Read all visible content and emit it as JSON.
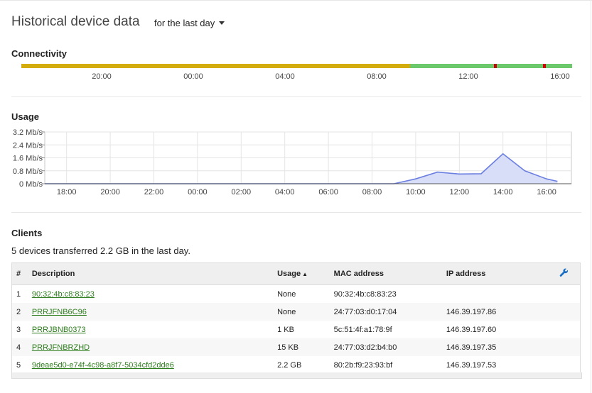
{
  "page": {
    "title": "Historical device data",
    "range_label": "for the last day"
  },
  "connectivity": {
    "title": "Connectivity",
    "colors": {
      "poor": "#d4ac0d",
      "good": "#6bc96b",
      "offline": "#cc0000"
    },
    "ticks": [
      "20:00",
      "00:00",
      "04:00",
      "08:00",
      "12:00",
      "16:00"
    ]
  },
  "usage": {
    "title": "Usage",
    "line_color": "#6b7fe0",
    "fill_color": "#d8ddf8"
  },
  "chart_data": {
    "type": "area",
    "title": "",
    "xlabel": "",
    "ylabel": "",
    "y_unit": "Mb/s",
    "y_ticks": [
      "0 Mb/s",
      "0.8 Mb/s",
      "1.6 Mb/s",
      "2.4 Mb/s",
      "3.2 Mb/s"
    ],
    "ylim": [
      0,
      3.2
    ],
    "x_ticks": [
      "18:00",
      "20:00",
      "22:00",
      "00:00",
      "02:00",
      "04:00",
      "06:00",
      "08:00",
      "10:00",
      "12:00",
      "14:00",
      "16:00"
    ],
    "grid": true,
    "series": [
      {
        "x": [
          "17:00",
          "18:00",
          "19:00",
          "20:00",
          "21:00",
          "22:00",
          "23:00",
          "00:00",
          "01:00",
          "02:00",
          "03:00",
          "04:00",
          "05:00",
          "06:00",
          "07:00",
          "08:00",
          "09:00",
          "10:00",
          "11:00",
          "12:00",
          "13:00",
          "14:00",
          "15:00",
          "16:00",
          "16:30"
        ],
        "values": [
          0,
          0,
          0,
          0,
          0,
          0,
          0,
          0,
          0,
          0,
          0,
          0,
          0,
          0,
          0,
          0,
          0,
          0.3,
          0.72,
          0.6,
          0.62,
          1.85,
          0.8,
          0.3,
          0.15
        ]
      }
    ]
  },
  "clients": {
    "title": "Clients",
    "summary": "5 devices transferred 2.2 GB in the last day.",
    "columns": {
      "num": "#",
      "description": "Description",
      "usage": "Usage",
      "mac": "MAC address",
      "ip": "IP address"
    },
    "rows": [
      {
        "num": "1",
        "description": "90:32:4b:c8:83:23",
        "usage": "None",
        "mac": "90:32:4b:c8:83:23",
        "ip": ""
      },
      {
        "num": "2",
        "description": "PRRJFNB6C96",
        "usage": "None",
        "mac": "24:77:03:d0:17:04",
        "ip": "146.39.197.86"
      },
      {
        "num": "3",
        "description": "PRRJBNB0373",
        "usage": "1 KB",
        "mac": "5c:51:4f:a1:78:9f",
        "ip": "146.39.197.60"
      },
      {
        "num": "4",
        "description": "PRRJFNBRZHD",
        "usage": "15 KB",
        "mac": "24:77:03:d2:b4:b0",
        "ip": "146.39.197.35"
      },
      {
        "num": "5",
        "description": "9deae5d0-e74f-4c98-a8f7-5034cfd2dde6",
        "usage": "2.2 GB",
        "mac": "80:2b:f9:23:93:bf",
        "ip": "146.39.197.53"
      }
    ],
    "link_color": "#2e7d1e",
    "wrench_icon": "wrench-icon",
    "wrench_color": "#1a6fc4"
  }
}
